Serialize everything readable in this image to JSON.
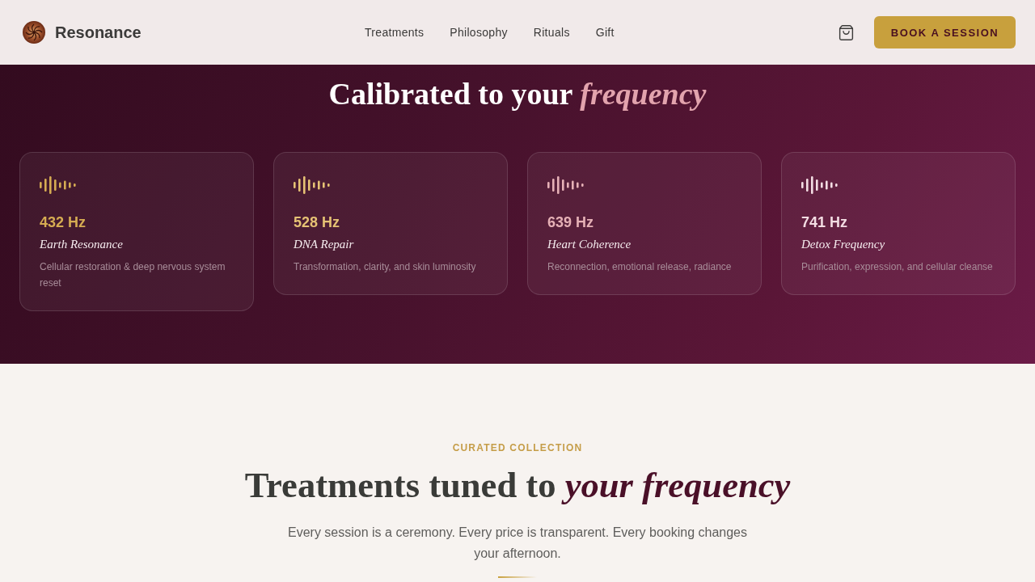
{
  "header": {
    "brand": "Resonance",
    "nav": [
      "Treatments",
      "Philosophy",
      "Rituals",
      "Gift"
    ],
    "cta": "BOOK A SESSION"
  },
  "hero": {
    "title": "Calibrated to your *frequency*",
    "cards": [
      {
        "frequency": "432 Hz",
        "name": "Earth Resonance",
        "description": "Cellular restoration & deep nervous system reset",
        "color": "#d6ac52"
      },
      {
        "frequency": "528 Hz",
        "name": "DNA Repair",
        "description": "Transformation, clarity, and skin luminosity",
        "color": "#e6c274"
      },
      {
        "frequency": "639 Hz",
        "name": "Heart Coherence",
        "description": "Reconnection, emotional release, radiance",
        "color": "#e6b1b6"
      },
      {
        "frequency": "741 Hz",
        "name": "Detox Frequency",
        "description": "Purification, expression, and cellular cleanse",
        "color": "#f3dde3"
      }
    ]
  },
  "collection": {
    "eyebrow": "CURATED COLLECTION",
    "title": "Treatments tuned to *your frequency*",
    "intro": "Every session is a ceremony. Every price is transparent. Every booking changes your afternoon."
  }
}
